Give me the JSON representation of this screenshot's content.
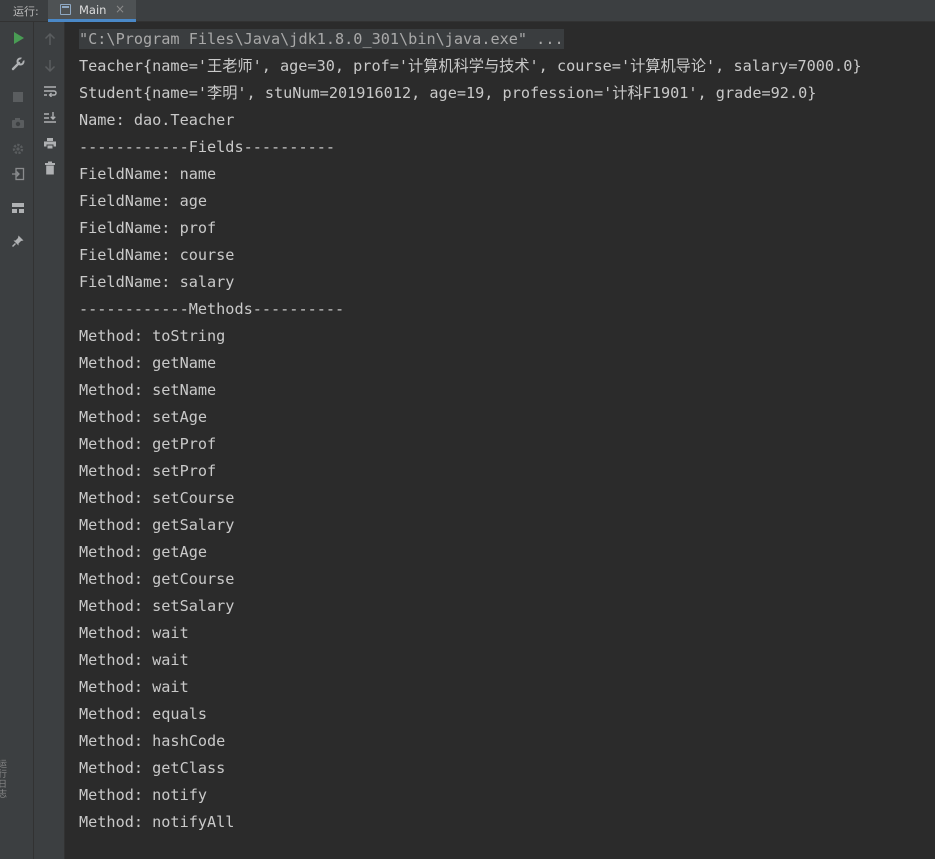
{
  "header": {
    "run_label": "运行:",
    "tab_label": "Main",
    "tab_close": "×"
  },
  "toolbar": {
    "vertical_text": "运行 日志"
  },
  "console": {
    "lines": [
      "\"C:\\Program Files\\Java\\jdk1.8.0_301\\bin\\java.exe\" ...",
      "Teacher{name='王老师', age=30, prof='计算机科学与技术', course='计算机导论', salary=7000.0}",
      "Student{name='李明', stuNum=201916012, age=19, profession='计科F1901', grade=92.0}",
      "Name: dao.Teacher",
      "------------Fields----------",
      "FieldName: name",
      "FieldName: age",
      "FieldName: prof",
      "FieldName: course",
      "FieldName: salary",
      "------------Methods----------",
      "Method: toString",
      "Method: getName",
      "Method: setName",
      "Method: setAge",
      "Method: getProf",
      "Method: setProf",
      "Method: setCourse",
      "Method: getSalary",
      "Method: getAge",
      "Method: getCourse",
      "Method: setSalary",
      "Method: wait",
      "Method: wait",
      "Method: wait",
      "Method: equals",
      "Method: hashCode",
      "Method: getClass",
      "Method: notify",
      "Method: notifyAll"
    ]
  },
  "colors": {
    "background": "#2b2b2b",
    "panel": "#3c3f41",
    "text": "#c9c9c9",
    "run_green": "#499c54",
    "tab_underline": "#4a88c7"
  },
  "icons": [
    "run-icon",
    "wrench-icon",
    "stop-icon",
    "camera-icon",
    "debug-settings-icon",
    "exit-icon",
    "layout-icon",
    "pin-icon",
    "up-arrow-icon",
    "down-arrow-icon",
    "soft-wrap-icon",
    "scroll-to-end-icon",
    "print-icon",
    "trash-icon"
  ]
}
